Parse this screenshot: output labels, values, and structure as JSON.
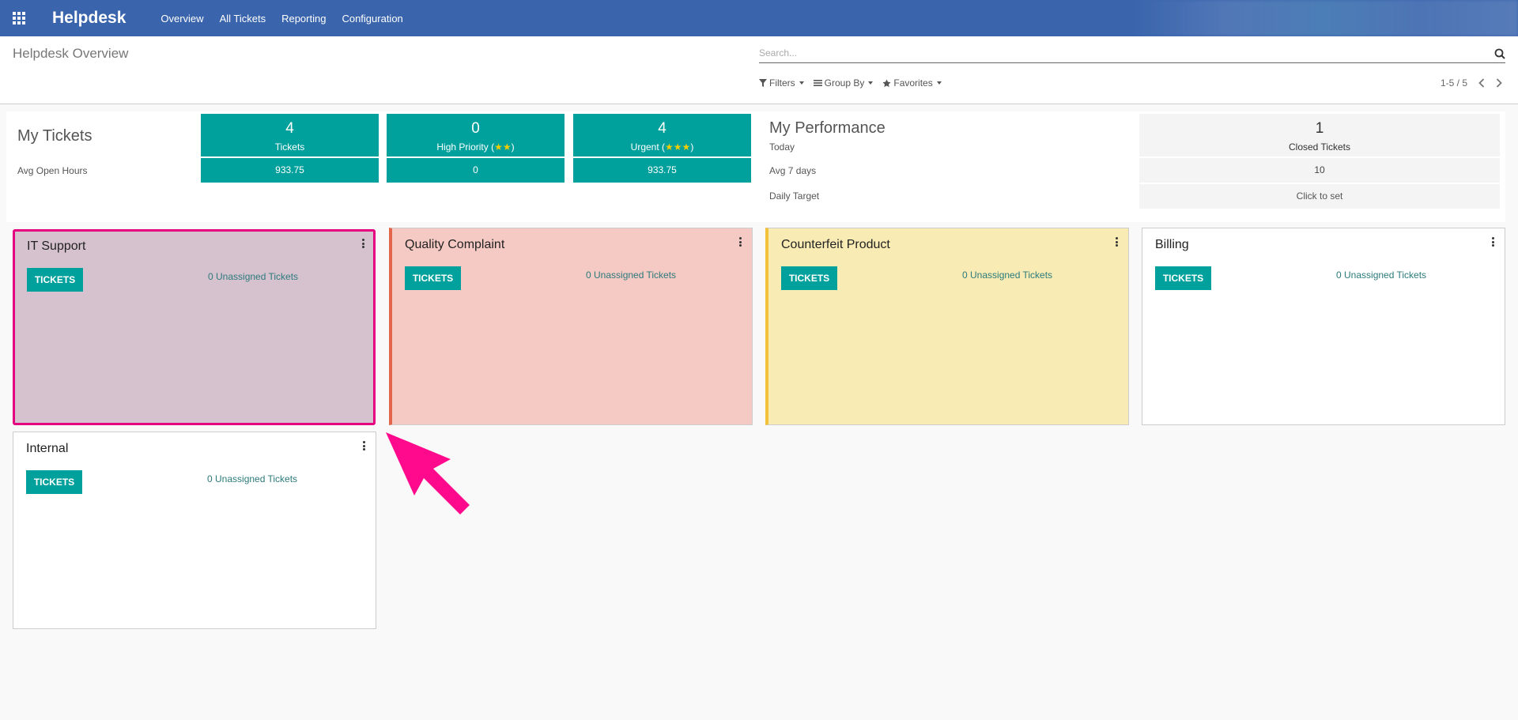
{
  "app": {
    "brand": "Helpdesk",
    "menu": [
      "Overview",
      "All Tickets",
      "Reporting",
      "Configuration"
    ]
  },
  "control_panel": {
    "title": "Helpdesk Overview",
    "search_placeholder": "Search...",
    "filters_label": "Filters",
    "group_by_label": "Group By",
    "favorites_label": "Favorites",
    "pager": "1-5 / 5"
  },
  "dashboard": {
    "my_tickets_label": "My Tickets",
    "avg_open_hours_label": "Avg Open Hours",
    "tickets": {
      "count": "4",
      "label": "Tickets",
      "avg": "933.75"
    },
    "high_priority": {
      "count": "0",
      "label_prefix": "High Priority (",
      "stars": "★★",
      "label_suffix": ")",
      "avg": "0"
    },
    "urgent": {
      "count": "4",
      "label_prefix": "Urgent (",
      "stars": "★★★",
      "label_suffix": ")",
      "avg": "933.75"
    },
    "my_performance_label": "My Performance",
    "today_label": "Today",
    "avg7_label": "Avg 7 days",
    "daily_target_label": "Daily Target",
    "closed": {
      "count": "1",
      "label": "Closed Tickets"
    },
    "avg7_value": "10",
    "daily_target_value": "Click to set"
  },
  "teams": [
    {
      "name": "IT Support",
      "button": "TICKETS",
      "unassigned": "0 Unassigned Tickets",
      "color": "#d6c2ce",
      "stripe": ""
    },
    {
      "name": "Quality Complaint",
      "button": "TICKETS",
      "unassigned": "0 Unassigned Tickets",
      "color": "#f5c9c4",
      "stripe": "#e4664a"
    },
    {
      "name": "Counterfeit Product",
      "button": "TICKETS",
      "unassigned": "0 Unassigned Tickets",
      "color": "#f8ebb4",
      "stripe": "#f3c23a"
    },
    {
      "name": "Billing",
      "button": "TICKETS",
      "unassigned": "0 Unassigned Tickets",
      "color": "#ffffff",
      "stripe": ""
    },
    {
      "name": "Internal",
      "button": "TICKETS",
      "unassigned": "0 Unassigned Tickets",
      "color": "#ffffff",
      "stripe": ""
    }
  ],
  "colors": {
    "navbar": "#3a65ad",
    "accent": "#00a09d",
    "highlight": "#e4007f"
  }
}
